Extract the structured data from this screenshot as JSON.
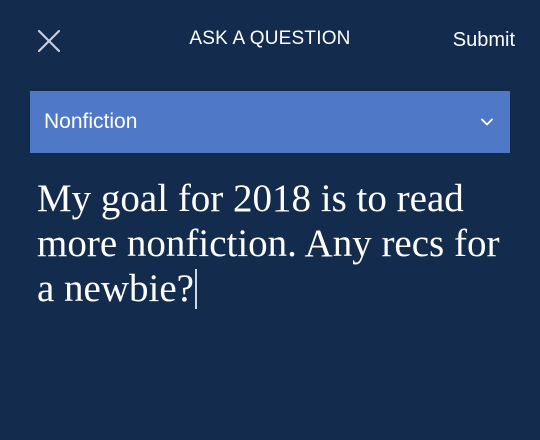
{
  "header": {
    "title": "ASK A QUESTION",
    "close_icon": "close-icon",
    "submit_label": "Submit"
  },
  "genre_select": {
    "selected_value": "Nonfiction",
    "chevron_icon": "chevron-down-icon"
  },
  "question": {
    "text": "My goal for 2018 is to read more nonfiction. Any recs for a newbie?"
  },
  "colors": {
    "background": "#132b4c",
    "select_background": "#4f79c7",
    "text": "#ffffff"
  }
}
